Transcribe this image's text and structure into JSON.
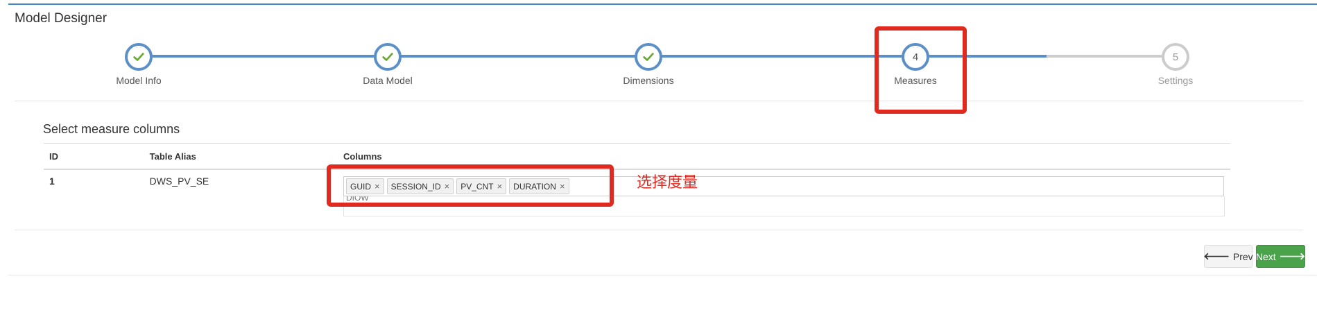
{
  "page": {
    "title": "Model Designer"
  },
  "wizard": {
    "steps": [
      {
        "number": "1",
        "label": "Model Info",
        "state": "completed"
      },
      {
        "number": "2",
        "label": "Data Model",
        "state": "completed"
      },
      {
        "number": "3",
        "label": "Dimensions",
        "state": "completed"
      },
      {
        "number": "4",
        "label": "Measures",
        "state": "current"
      },
      {
        "number": "5",
        "label": "Settings",
        "state": "pending"
      }
    ]
  },
  "measures": {
    "heading": "Select measure columns",
    "table": {
      "headers": [
        "ID",
        "Table Alias",
        "Columns"
      ],
      "rows": [
        {
          "id": "1",
          "alias": "DWS_PV_SE",
          "columns": [
            "GUID",
            "SESSION_ID",
            "PV_CNT",
            "DURATION"
          ],
          "dropdown_partial": "DIOW"
        }
      ]
    }
  },
  "annotation": {
    "text": "选择度量",
    "color": "#e02a1f"
  },
  "buttons": {
    "prev": "Prev",
    "next": "Next"
  },
  "colors": {
    "accent": "#5b8fc7",
    "check": "#6aa832",
    "success": "#4aa24a",
    "pending": "#cccccc"
  },
  "icons": {
    "completed": "check-icon",
    "prev": "arrow-left-icon",
    "next": "arrow-right-icon",
    "tag_remove": "close-icon"
  }
}
